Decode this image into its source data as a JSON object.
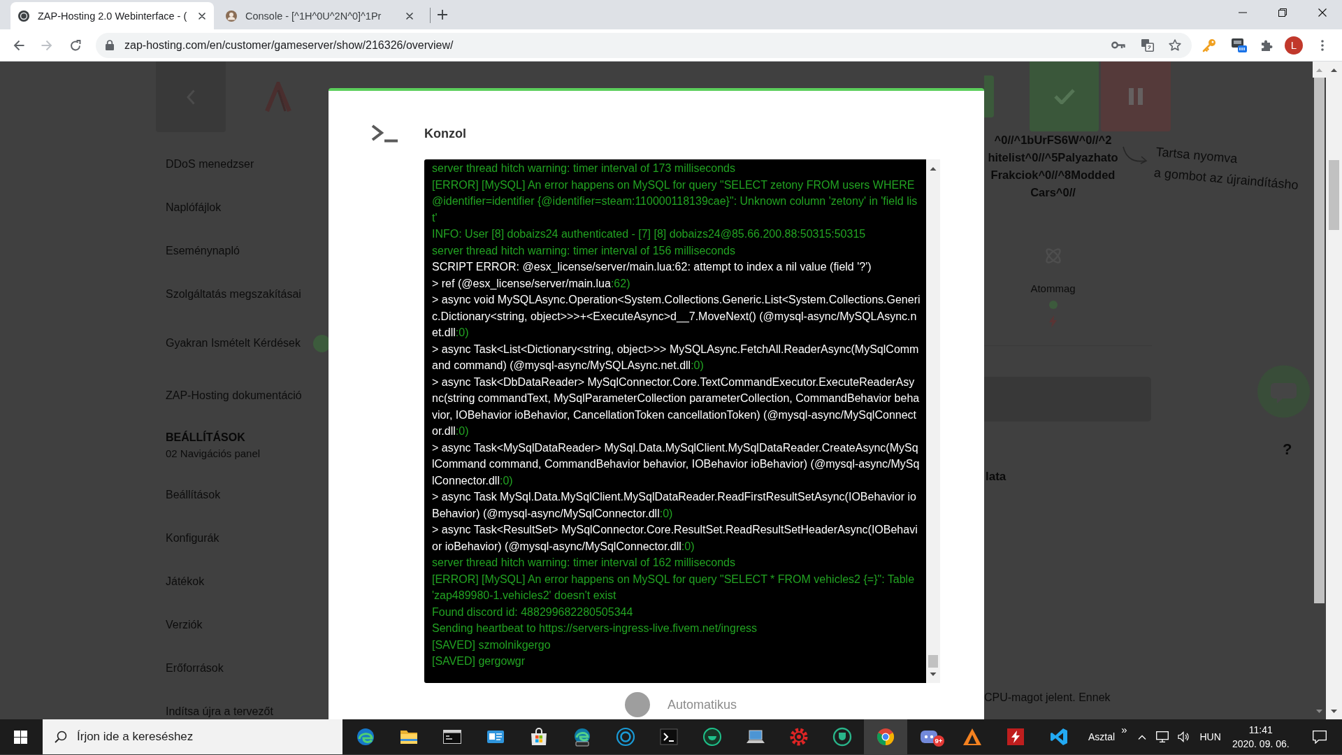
{
  "browser": {
    "tabs": [
      {
        "kind": "logo",
        "title": "ZAP-Hosting 2.0 Webinterface - (",
        "selected": true
      },
      {
        "kind": "avatar",
        "title": "Console - [^1H^0U^2N^0]^1Pr",
        "selected": false
      }
    ],
    "forward_disabled": true,
    "address": "zap-hosting.com/en/customer/gameserver/show/216326/overview/",
    "profile_initial": "L"
  },
  "page": {
    "sidebar": {
      "items": [
        {
          "label": "DDoS menedzser",
          "indicator": false
        },
        {
          "label": "Naplófájlok",
          "indicator": false
        },
        {
          "label": "Eseménynapló",
          "indicator": false
        },
        {
          "label": "Szolgáltatás megszakításai",
          "indicator": false
        },
        {
          "label": "Gyakran Ismételt Kérdések",
          "indicator": true
        },
        {
          "label": "ZAP-Hosting dokumentáció",
          "indicator": false
        }
      ],
      "section": {
        "title": "BEÁLLÍTÁSOK",
        "subtitle": "02 Navigációs panel",
        "items": [
          "Beállítások",
          "Konfigurák",
          "Játékok",
          "Verziók",
          "Erőforrások",
          "Indítsa újra a tervezőt"
        ]
      }
    },
    "server_name": [
      "^0//^1bUrFS6W^0//^2",
      "hitelist^0//^5Palyazhato",
      "Frakciok^0//^8Modded",
      "Cars^0//"
    ],
    "restart_hint": [
      "Tartsa nyomva",
      "a gombot az újraindításho"
    ],
    "core_label": "Atommag",
    "help": "?",
    "heading_fragment": "lata",
    "text_fragment": "CPU-magot jelent. Ennek"
  },
  "modal": {
    "title": "Konzol",
    "console": {
      "lines": [
        {
          "kind": "log",
          "text": "server thread hitch warning: timer interval of 173 milliseconds"
        },
        {
          "kind": "log",
          "text": "[ERROR] [MySQL] An error happens on MySQL for query \"SELECT zetony FROM users WHERE @identifier=identifier {@identifier=steam:110000118139cae}\": Unknown column 'zetony' in 'field list'"
        },
        {
          "kind": "log",
          "text": "INFO: User [8] dobaizs24 authenticated - [7] [8] dobaizs24@85.66.200.88:50315:50315"
        },
        {
          "kind": "log",
          "text": "server thread hitch warning: timer interval of 156 milliseconds"
        },
        {
          "kind": "error",
          "text": "SCRIPT ERROR: @esx_license/server/main.lua:62: attempt to index a nil value (field '?')"
        },
        {
          "kind": "trace",
          "text": "> ref (@esx_license/server/main.lua",
          "location": ":62)"
        },
        {
          "kind": "trace",
          "text": "> async void MySQLAsync.Operation<System.Collections.Generic.List<System.Collections.Generic.Dictionary<string, object>>>+<ExecuteAsync>d__7.MoveNext() (@mysql-async/MySQLAsync.net.dll",
          "location": ":0)"
        },
        {
          "kind": "trace",
          "text": "> async Task<List<Dictionary<string, object>>> MySQLAsync.FetchAll.ReaderAsync(MySqlCommand command) (@mysql-async/MySQLAsync.net.dll",
          "location": ":0)"
        },
        {
          "kind": "trace",
          "text": "> async Task<DbDataReader> MySqlConnector.Core.TextCommandExecutor.ExecuteReaderAsync(string commandText, MySqlParameterCollection parameterCollection, CommandBehavior behavior, IOBehavior ioBehavior, CancellationToken cancellationToken) (@mysql-async/MySqlConnector.dll",
          "location": ":0)"
        },
        {
          "kind": "trace",
          "text": "> async Task<MySqlDataReader> MySql.Data.MySqlClient.MySqlDataReader.CreateAsync(MySqlCommand command, CommandBehavior behavior, IOBehavior ioBehavior) (@mysql-async/MySqlConnector.dll",
          "location": ":0)"
        },
        {
          "kind": "trace",
          "text": "> async Task MySql.Data.MySqlClient.MySqlDataReader.ReadFirstResultSetAsync(IOBehavior ioBehavior) (@mysql-async/MySqlConnector.dll",
          "location": ":0)"
        },
        {
          "kind": "trace",
          "text": "> async Task<ResultSet> MySqlConnector.Core.ResultSet.ReadResultSetHeaderAsync(IOBehavior ioBehavior) (@mysql-async/MySqlConnector.dll",
          "location": ":0)"
        },
        {
          "kind": "log",
          "text": "server thread hitch warning: timer interval of 162 milliseconds"
        },
        {
          "kind": "log",
          "text": "[ERROR] [MySQL] An error happens on MySQL for query \"SELECT * FROM vehicles2 {=}\": Table 'zap489980-1.vehicles2' doesn't exist"
        },
        {
          "kind": "log",
          "text": "Found discord id: 488299682280505344"
        },
        {
          "kind": "log",
          "text": "Sending heartbeat to https://servers-ingress-live.fivem.net/ingress"
        },
        {
          "kind": "log",
          "text": "[SAVED] szmolnikgergo"
        },
        {
          "kind": "log",
          "text": "[SAVED] gergowgr"
        }
      ]
    },
    "auto_restart": {
      "label": "Automatikus",
      "on": false
    }
  },
  "taskbar": {
    "search": {
      "placeholder": "Írjon ide a kereséshez"
    },
    "apps": [
      {
        "kind": "swirl",
        "selected": false
      },
      {
        "kind": "folder",
        "selected": false
      },
      {
        "kind": "console",
        "selected": false
      },
      {
        "kind": "card",
        "selected": false
      },
      {
        "kind": "bag",
        "selected": false
      },
      {
        "kind": "swirl_beta",
        "selected": false
      },
      {
        "kind": "ring",
        "selected": false
      },
      {
        "kind": "prompt",
        "selected": false
      },
      {
        "kind": "arc",
        "selected": false
      },
      {
        "kind": "laptop",
        "selected": false
      },
      {
        "kind": "gear",
        "selected": false
      },
      {
        "kind": "shield",
        "selected": false
      },
      {
        "kind": "wheel",
        "selected": true
      },
      {
        "kind": "chat",
        "selected": false,
        "badge": "9+"
      },
      {
        "kind": "triangle",
        "selected": false
      },
      {
        "kind": "tile",
        "selected": false
      },
      {
        "kind": "ribbon",
        "selected": false
      }
    ],
    "toolbar_label": "Asztal",
    "more": "»",
    "language": "HUN",
    "time": "11:41",
    "date": "2020. 09. 06."
  }
}
